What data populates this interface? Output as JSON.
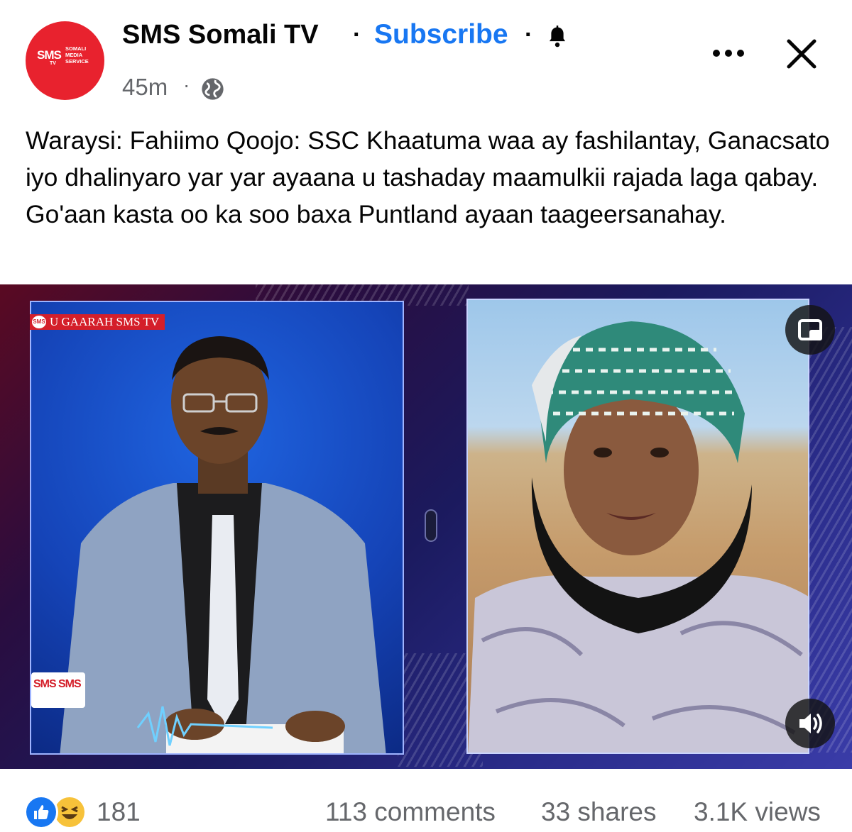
{
  "header": {
    "page_name": "SMS Somali TV",
    "separator": "·",
    "subscribe_label": "Subscribe",
    "time": "45m",
    "time_separator": "·",
    "avatar": {
      "logo_sms": "SMS",
      "logo_tv": "TV",
      "logo_lines": [
        "SOMALI",
        "MEDIA",
        "SERVICE"
      ]
    },
    "icons": {
      "bell": "bell-icon",
      "globe": "globe-icon",
      "more": "more-icon",
      "close": "close-icon"
    }
  },
  "post": {
    "caption": "Waraysi: Fahiimo Qoojo: SSC Khaatuma waa ay fashilantay, Ganacsato iyo dhalinyaro yar yar ayaana u tashaday maamulkii rajada laga qabay.  Go'aan kasta oo ka soo baxa Puntland ayaan taageersanahay."
  },
  "video": {
    "ticker_badge_mini": "SMS",
    "ticker_badge": "U GAARAH SMS TV",
    "corner_logo_left": "SMS",
    "corner_logo_right": "SMS",
    "icons": {
      "pip": "picture-in-picture-icon",
      "volume": "volume-icon"
    }
  },
  "footer": {
    "reactions_count": "181",
    "comments": "113 comments",
    "shares": "33 shares",
    "views": "3.1K views",
    "reaction_icons": [
      "like-icon",
      "haha-icon"
    ]
  },
  "colors": {
    "brand_red": "#e8222e",
    "link_blue": "#1877f2",
    "secondary_text": "#65676b"
  }
}
